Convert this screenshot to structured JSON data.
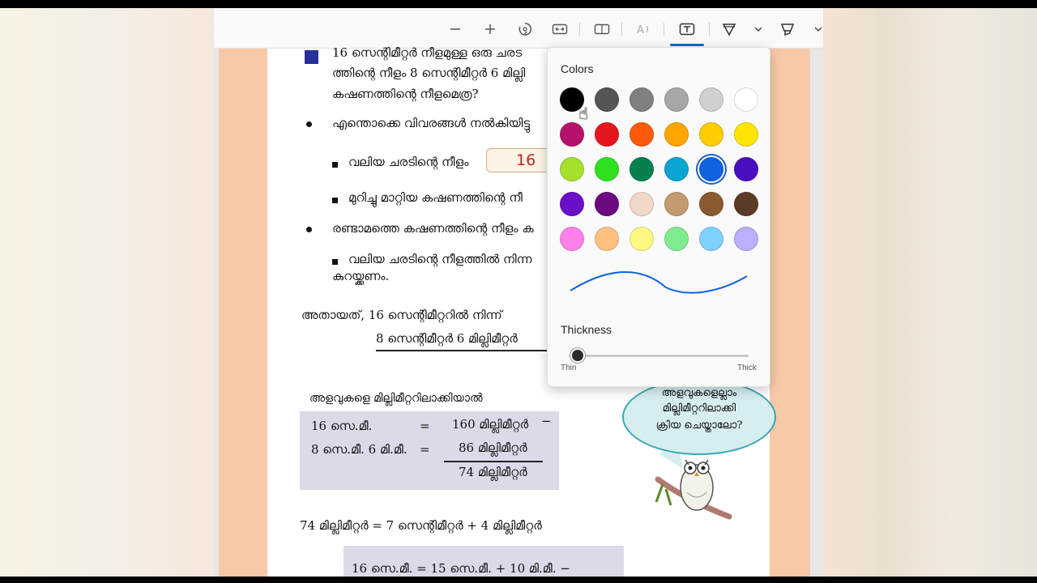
{
  "toolbar": {
    "zoom_out_icon": "minus-icon",
    "zoom_in_icon": "plus-icon",
    "rotate_icon": "rotate-icon",
    "fit_width_icon": "fit-width-icon",
    "page_view_icon": "page-view-icon",
    "read_aloud_icon": "read-aloud-icon",
    "text_icon": "text-box-icon",
    "draw_icon": "draw-icon",
    "highlight_icon": "highlight-icon"
  },
  "document": {
    "q_line1": "16 സെന്റിമീറ്റർ നീളമുള്ള ഒരു ചരട",
    "q_line2": "ത്തിന്റെ നീളം 8 സെന്റിമീറ്റർ 6 മില്ലി",
    "q_line3": "കഷണത്തിന്റെ നീളമെത്ര?",
    "b1": "എന്തൊക്കെ വിവരങ്ങൾ നൽകിയിട്ടു",
    "s1": "വലിയ ചരടിന്റെ നീളം",
    "answer": "16",
    "s2": "മുറിച്ചു മാറ്റിയ കഷണത്തിന്റെ നീ",
    "b2": "രണ്ടാമത്തെ കഷണത്തിന്റെ നീളം ക",
    "s3_line1": "വലിയ ചരടിന്റെ നീളത്തിൽ നിന്ന",
    "s3_line2": "കുറയ്ക്കണം.",
    "that_is": "അതായത്,  16 സെന്റിമീറ്ററിൽ  നിന്ന്",
    "sub_line": "8 സെന്റിമീറ്റർ  6 മില്ലിമീറ്റർ",
    "convert": "അളവുകളെ മില്ലിമീറ്ററിലാക്കിയാൽ",
    "calc_r1_left": "16  സെ.മീ.",
    "calc_r1_eq": "=",
    "calc_r1_right": "160  മില്ലിമീറ്റർ",
    "calc_minus": "−",
    "calc_r2_left": "8  സെ.മീ.  6  മി.മീ.",
    "calc_r2_eq": "=",
    "calc_r2_right": "86  മില്ലിമീറ്റർ",
    "calc_r3_right": "74  മില്ലിമീറ്റർ",
    "final_line": "74  മില്ലിമീറ്റർ   =   7  സെന്റിമീറ്റർ + 4  മില്ലിമീറ്റർ",
    "bottom_partial": "16  സെ.മീ.   =   15  സെ.മീ.   +   10  മി.മീ.  −",
    "bubble_l1": "അളവുകളെല്ലാം",
    "bubble_l2": "മില്ലിമീറ്ററിലാക്കി",
    "bubble_l3": "ക്രിയ  ചെയ്താലോ?"
  },
  "color_panel": {
    "title": "Colors",
    "swatches": [
      [
        "#000000",
        "#555555",
        "#808080",
        "#a6a6a6",
        "#d0d0d0",
        "#ffffff"
      ],
      [
        "#b5136b",
        "#e5151f",
        "#ff5a0a",
        "#ffa500",
        "#ffcc00",
        "#ffe600"
      ],
      [
        "#a4e02c",
        "#2fe020",
        "#078050",
        "#0aa5d2",
        "#0f62e0",
        "#4a0fc0"
      ],
      [
        "#6a10c8",
        "#6b0a80",
        "#f2d8c8",
        "#c49a70",
        "#8a5a30",
        "#5c3a28"
      ],
      [
        "#ff80e8",
        "#ffc080",
        "#fff880",
        "#80ec90",
        "#80d0ff",
        "#bab0ff"
      ]
    ],
    "selected": "#0f62e0",
    "thickness_title": "Thickness",
    "thin_label": "Thin",
    "thick_label": "Thick",
    "thickness_value": 0.05
  }
}
